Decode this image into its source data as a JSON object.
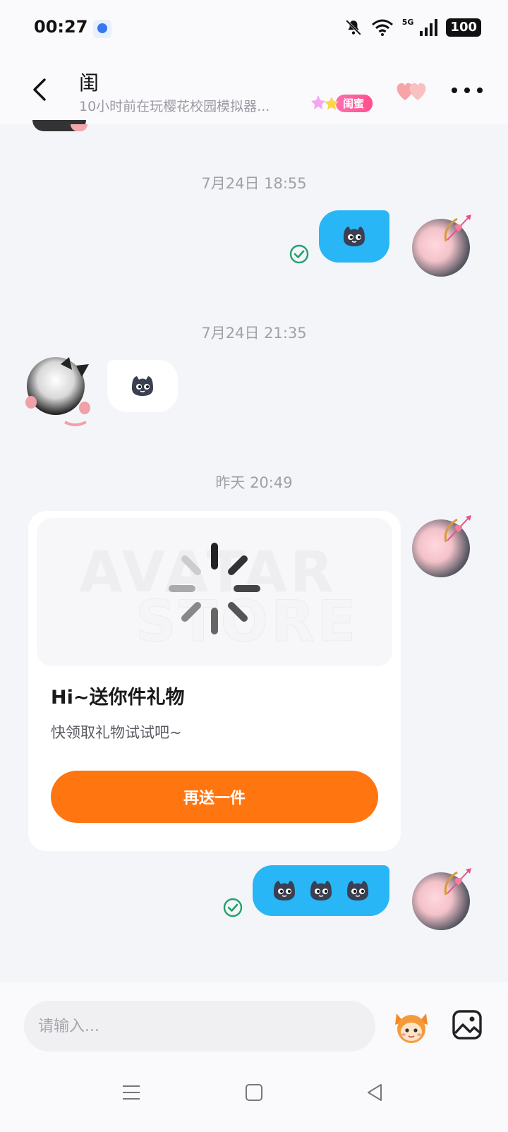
{
  "status_bar": {
    "time": "00:27",
    "network_label": "5G",
    "battery": "100",
    "icons": [
      "baidu-app-icon",
      "mute-bell-icon",
      "wifi-icon",
      "signal-icon",
      "battery-icon"
    ]
  },
  "header": {
    "name": "闺",
    "subtitle": "10小时前在玩樱花校园模拟器...",
    "badge_label": "闺蜜",
    "icons": [
      "back-arrow-icon",
      "hearts-icon",
      "more-icon"
    ]
  },
  "messages": [
    {
      "type": "timestamp",
      "text": "7月24日 18:55"
    },
    {
      "type": "sticker",
      "from": "me",
      "count": 1,
      "status": "read"
    },
    {
      "type": "timestamp",
      "text": "7月24日 21:35"
    },
    {
      "type": "sticker",
      "from": "them",
      "count": 1
    },
    {
      "type": "timestamp",
      "text": "昨天 20:49"
    },
    {
      "type": "gift",
      "from": "me"
    },
    {
      "type": "sticker",
      "from": "me",
      "count": 3,
      "status": "read"
    }
  ],
  "gift_card": {
    "watermark_line1": "AVATAR",
    "watermark_line2": "STORE",
    "title": "Hi~送你件礼物",
    "description": "快领取礼物试试吧~",
    "button_label": "再送一件"
  },
  "input_bar": {
    "placeholder": "请输入...",
    "icons": [
      "mascot-icon",
      "image-icon"
    ]
  },
  "nav_bar": {
    "icons": [
      "menu-icon",
      "home-icon",
      "back-icon"
    ]
  },
  "colors": {
    "my_bubble": "#29b6f6",
    "their_bubble": "#ffffff",
    "gift_button": "#ff7510",
    "read_check": "#22a06b",
    "background": "#f4f5f9"
  }
}
